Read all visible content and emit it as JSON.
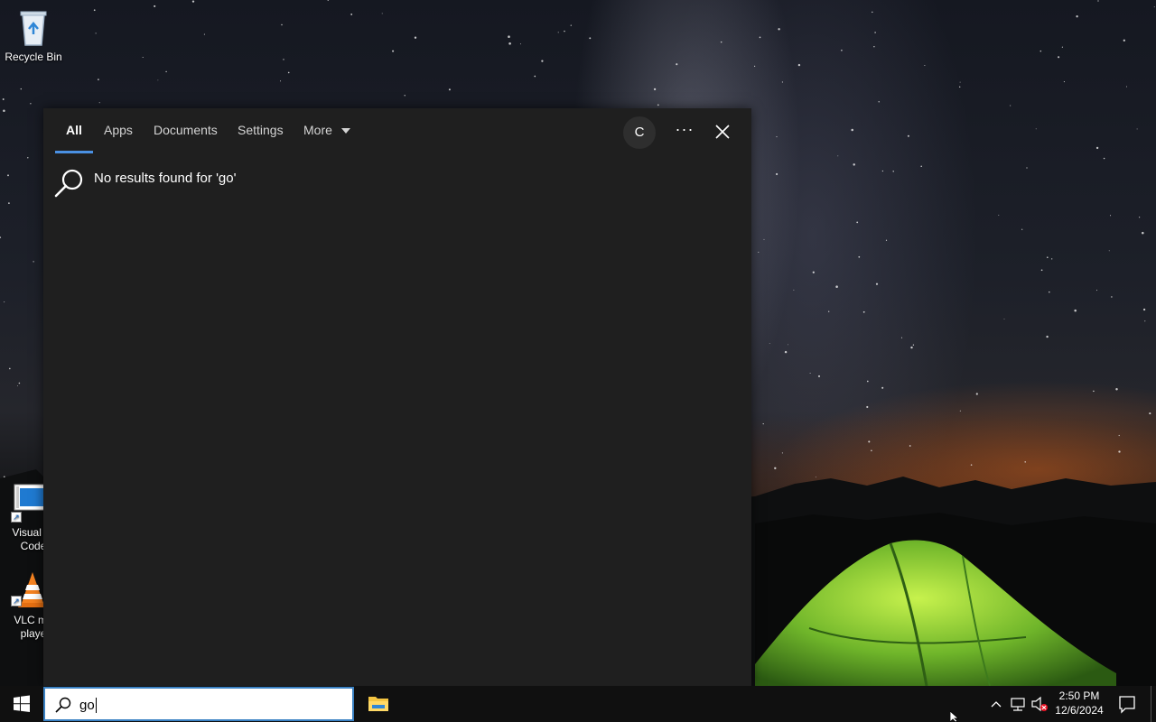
{
  "desktop": {
    "icons": [
      {
        "name": "recycle-bin",
        "label": "Recycle Bin",
        "label_lines": [
          "Recycle Bin"
        ]
      },
      {
        "name": "visual-studio-code",
        "label_lines": [
          "Visual St",
          "Code"
        ]
      },
      {
        "name": "vlc-media-player",
        "label_lines": [
          "VLC me",
          "playe"
        ]
      }
    ]
  },
  "search_flyout": {
    "tabs": [
      {
        "label": "All",
        "active": true
      },
      {
        "label": "Apps",
        "active": false
      },
      {
        "label": "Documents",
        "active": false
      },
      {
        "label": "Settings",
        "active": false
      },
      {
        "label": "More",
        "active": false
      }
    ],
    "account_initial": "C",
    "more_options": "···",
    "no_results_text": "No results found for 'go'"
  },
  "taskbar": {
    "search_query": "go",
    "clock": {
      "time": "2:50 PM",
      "date": "12/6/2024"
    },
    "accent_color": "#3b82c4"
  },
  "icons": [
    "windows-logo-icon",
    "search-icon",
    "file-explorer-icon",
    "chevron-up-icon",
    "network-icon",
    "volume-muted-icon",
    "notification-icon",
    "close-icon",
    "magnifier-icon"
  ]
}
